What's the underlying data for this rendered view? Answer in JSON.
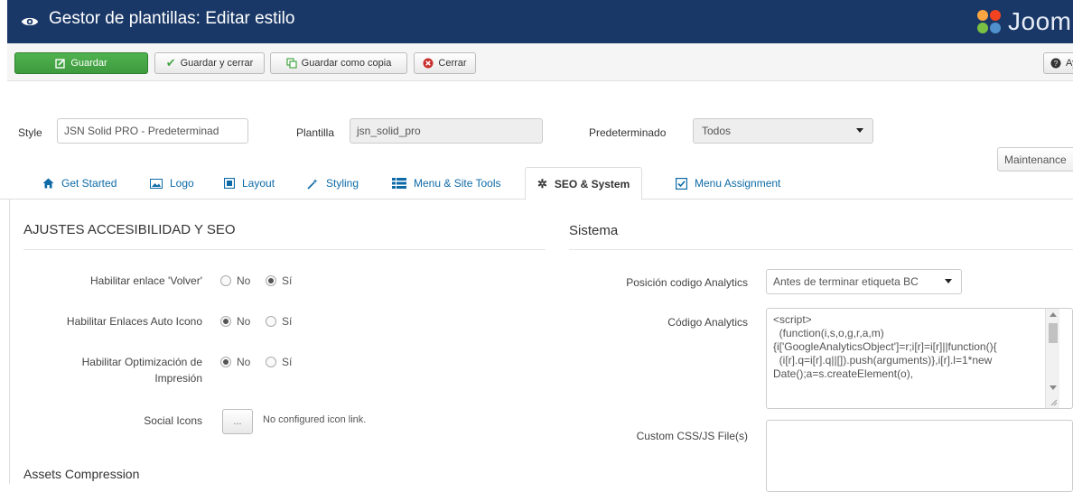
{
  "header": {
    "title": "Gestor de plantillas: Editar estilo",
    "brand": "Joomla!",
    "bg_color": "#1a3867"
  },
  "toolbar": {
    "save": "Guardar",
    "save_close": "Guardar y cerrar",
    "save_copy": "Guardar como copia",
    "close": "Cerrar",
    "help": "Ayuda"
  },
  "form": {
    "style_label": "Style",
    "style_value": "JSN Solid PRO - Predeterminad",
    "template_label": "Plantilla",
    "template_value": "jsn_solid_pro",
    "default_label": "Predeterminado",
    "default_value": "Todos",
    "maintenance": "Maintenance"
  },
  "tabs": [
    {
      "label": "Get Started",
      "icon": "home-icon"
    },
    {
      "label": "Logo",
      "icon": "picture-icon"
    },
    {
      "label": "Layout",
      "icon": "layout-icon"
    },
    {
      "label": "Styling",
      "icon": "magic-wand-icon"
    },
    {
      "label": "Menu & Site Tools",
      "icon": "list-icon"
    },
    {
      "label": "SEO & System",
      "icon": "gear-icon",
      "active": true
    },
    {
      "label": "Menu Assignment",
      "icon": "checkbox-icon"
    }
  ],
  "left": {
    "section_title": "AJUSTES ACCESIBILIDAD Y SEO",
    "rows": [
      {
        "label": "Habilitar enlace 'Volver'",
        "no": "No",
        "yes": "Sí",
        "selected": "yes"
      },
      {
        "label": "Habilitar Enlaces Auto Icono",
        "no": "No",
        "yes": "Sí",
        "selected": "no"
      },
      {
        "label": "Habilitar Optimización de Impresión",
        "no": "No",
        "yes": "Sí",
        "selected": "no"
      }
    ],
    "social_label": "Social Icons",
    "social_button": "...",
    "social_text": "No configured icon link.",
    "assets_title": "Assets Compression"
  },
  "right": {
    "section_title": "Sistema",
    "analytics_pos_label": "Posición codigo Analytics",
    "analytics_pos_value": "Antes de terminar etiqueta BC",
    "analytics_code_label": "Código Analytics",
    "analytics_code_lines": [
      "<script>",
      "  (function(i,s,o,g,r,a,m)",
      "{i['GoogleAnalyticsObject']=r;i[r]=i[r]||function(){",
      "  (i[r].q=i[r].q||[]).push(arguments)},i[r].l=1*new",
      "Date();a=s.createElement(o),"
    ],
    "custom_label": "Custom CSS/JS File(s)",
    "custom_value": ""
  },
  "colors": {
    "accent_green": "#46a546",
    "link_blue": "#0e6aa7",
    "close_red": "#c9302c"
  }
}
